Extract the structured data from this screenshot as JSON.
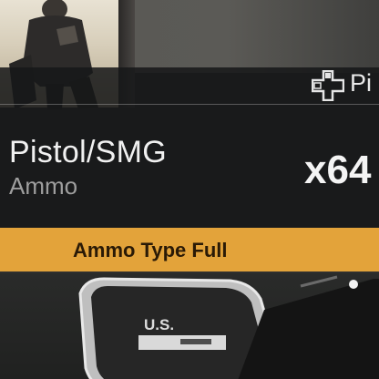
{
  "pickup": {
    "prompt_label": "Pi",
    "prompt_icon": "dpad-icon",
    "item_name": "Pistol/SMG",
    "item_type": "Ammo",
    "count": "x64"
  },
  "status": {
    "message": "Ammo Type Full",
    "color": "#e3a33a"
  },
  "world": {
    "plate_label": "U.S."
  },
  "colors": {
    "card_bg": "#161718",
    "text_primary": "#f1f1f1",
    "text_secondary": "#9e9e9e"
  }
}
